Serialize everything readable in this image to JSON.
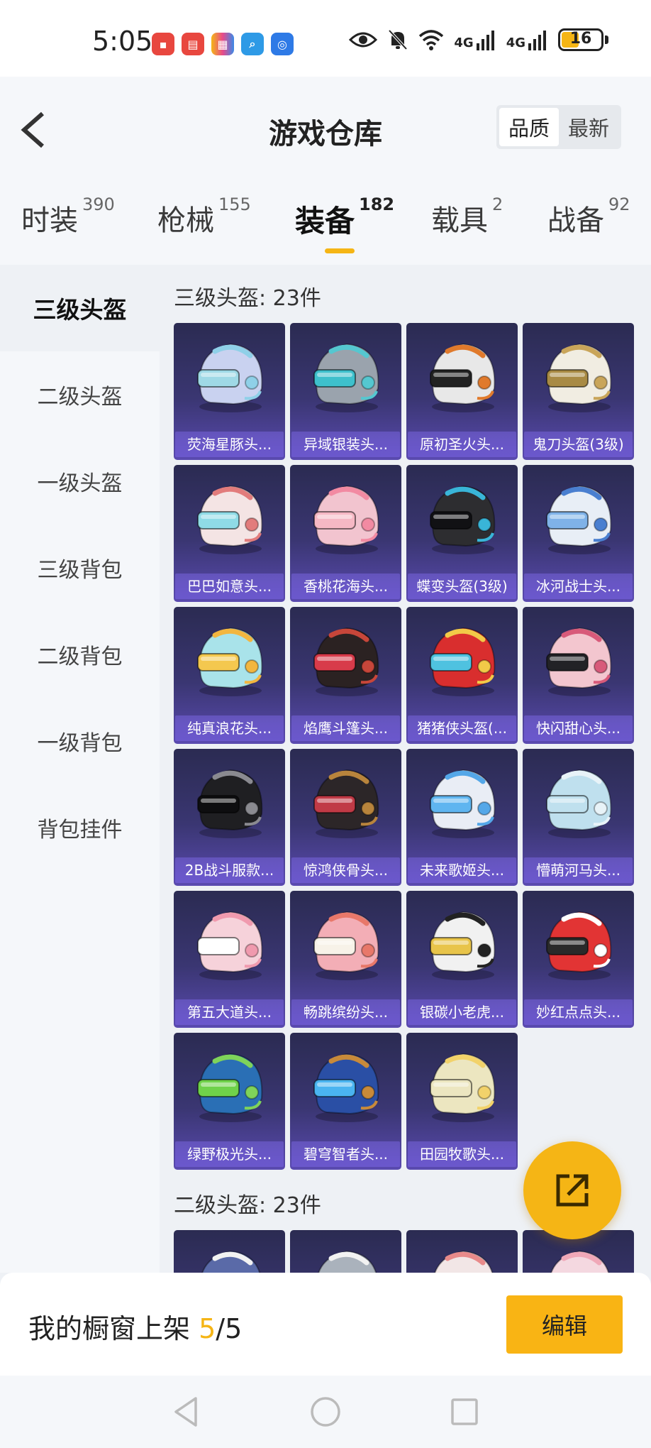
{
  "status_bar": {
    "time": "5:05",
    "signal1": "4G",
    "signal2": "4G",
    "battery": "16"
  },
  "header": {
    "title": "游戏仓库",
    "sort_options": [
      "品质",
      "最新"
    ]
  },
  "tabs": [
    {
      "label": "时装",
      "count": "390"
    },
    {
      "label": "枪械",
      "count": "155"
    },
    {
      "label": "装备",
      "count": "182"
    },
    {
      "label": "载具",
      "count": "2"
    },
    {
      "label": "战备",
      "count": "92"
    }
  ],
  "sidebar": {
    "items": [
      "三级头盔",
      "二级头盔",
      "一级头盔",
      "三级背包",
      "二级背包",
      "一级背包",
      "背包挂件"
    ]
  },
  "sections": [
    {
      "title": "三级头盔: 23件",
      "items": [
        {
          "name": "荧海星豚头...",
          "main": "#c9d2f0",
          "accent": "#8fd0e8",
          "visor": "#9fd9e6"
        },
        {
          "name": "异域银装头...",
          "main": "#9aa3ad",
          "accent": "#55c7d0",
          "visor": "#3ec0cc"
        },
        {
          "name": "原初圣火头...",
          "main": "#e8e8e8",
          "accent": "#e07a2c",
          "visor": "#222222"
        },
        {
          "name": "鬼刀头盔(3级)",
          "main": "#f1ede2",
          "accent": "#c9a55a",
          "visor": "#a88a44"
        },
        {
          "name": "巴巴如意头...",
          "main": "#f4e4e4",
          "accent": "#e27c7c",
          "visor": "#8fdbe6"
        },
        {
          "name": "香桃花海头...",
          "main": "#f2c4cf",
          "accent": "#f28aa2",
          "visor": "#f6b8c4"
        },
        {
          "name": "蝶变头盔(3级)",
          "main": "#2d2d30",
          "accent": "#39b5d8",
          "visor": "#111114"
        },
        {
          "name": "冰河战士头...",
          "main": "#e8eef6",
          "accent": "#4a7fd0",
          "visor": "#7fb2e8"
        },
        {
          "name": "纯真浪花头...",
          "main": "#a9e3ea",
          "accent": "#f2b640",
          "visor": "#f4c84f"
        },
        {
          "name": "焰鹰斗篷头...",
          "main": "#2b2222",
          "accent": "#c7463a",
          "visor": "#d83b4a"
        },
        {
          "name": "猪猪侠头盔(...",
          "main": "#d92e2e",
          "accent": "#f2c948",
          "visor": "#4fc2e0"
        },
        {
          "name": "快闪甜心头...",
          "main": "#f3c6cf",
          "accent": "#d85a7a",
          "visor": "#222226"
        },
        {
          "name": "2B战斗服款...",
          "main": "#1f1f22",
          "accent": "#8a8a90",
          "visor": "#0e0e10"
        },
        {
          "name": "惊鸿侠骨头...",
          "main": "#2c2628",
          "accent": "#b8843c",
          "visor": "#c03a46"
        },
        {
          "name": "未来歌姬头...",
          "main": "#e9edf5",
          "accent": "#54a7e8",
          "visor": "#5fb5f0"
        },
        {
          "name": "懵萌河马头...",
          "main": "#bfe0ee",
          "accent": "#e8f3f8",
          "visor": "#bfe0ee"
        },
        {
          "name": "第五大道头...",
          "main": "#f6d2da",
          "accent": "#f09aae",
          "visor": "#ffffff"
        },
        {
          "name": "畅跳缤纷头...",
          "main": "#f3aeb6",
          "accent": "#e8786a",
          "visor": "#f7f2e8"
        },
        {
          "name": "银碳小老虎...",
          "main": "#f1f1f1",
          "accent": "#222222",
          "visor": "#e8c44a"
        },
        {
          "name": "妙红点点头...",
          "main": "#e23434",
          "accent": "#ffffff",
          "visor": "#2a2a2a"
        },
        {
          "name": "绿野极光头...",
          "main": "#2a6fb5",
          "accent": "#7fd35a",
          "visor": "#6fd24a"
        },
        {
          "name": "碧穹智者头...",
          "main": "#2a4fa5",
          "accent": "#c88a3a",
          "visor": "#4ab4f0"
        },
        {
          "name": "田园牧歌头...",
          "main": "#ece6c0",
          "accent": "#f2d26a",
          "visor": "#ece6c0"
        }
      ]
    },
    {
      "title": "二级头盔: 23件",
      "items": [
        {
          "name": "",
          "main": "#5a6aa8",
          "accent": "#f2f2f2",
          "visor": "#5a6aa8"
        },
        {
          "name": "",
          "main": "#aab2bc",
          "accent": "#f2f2f2",
          "visor": "#aab2bc"
        },
        {
          "name": "",
          "main": "#f2e6e6",
          "accent": "#e88a8a",
          "visor": "#f2e6e6"
        },
        {
          "name": "",
          "main": "#f4d8e0",
          "accent": "#f0a8b8",
          "visor": "#f4d8e0"
        }
      ]
    }
  ],
  "bottom_bar": {
    "showcase_label": "我的橱窗上架",
    "showcase_current": "5",
    "showcase_sep": "/",
    "showcase_total": "5",
    "edit_label": "编辑"
  },
  "colors": {
    "accent": "#f5b515",
    "card_bg_top": "#2b2b52",
    "card_bg_bottom": "#5a4ab0"
  },
  "icons": {
    "back": "chevron-left-icon",
    "fab": "share-icon",
    "nav_back": "triangle-back-icon",
    "nav_home": "circle-home-icon",
    "nav_recent": "square-recent-icon"
  }
}
